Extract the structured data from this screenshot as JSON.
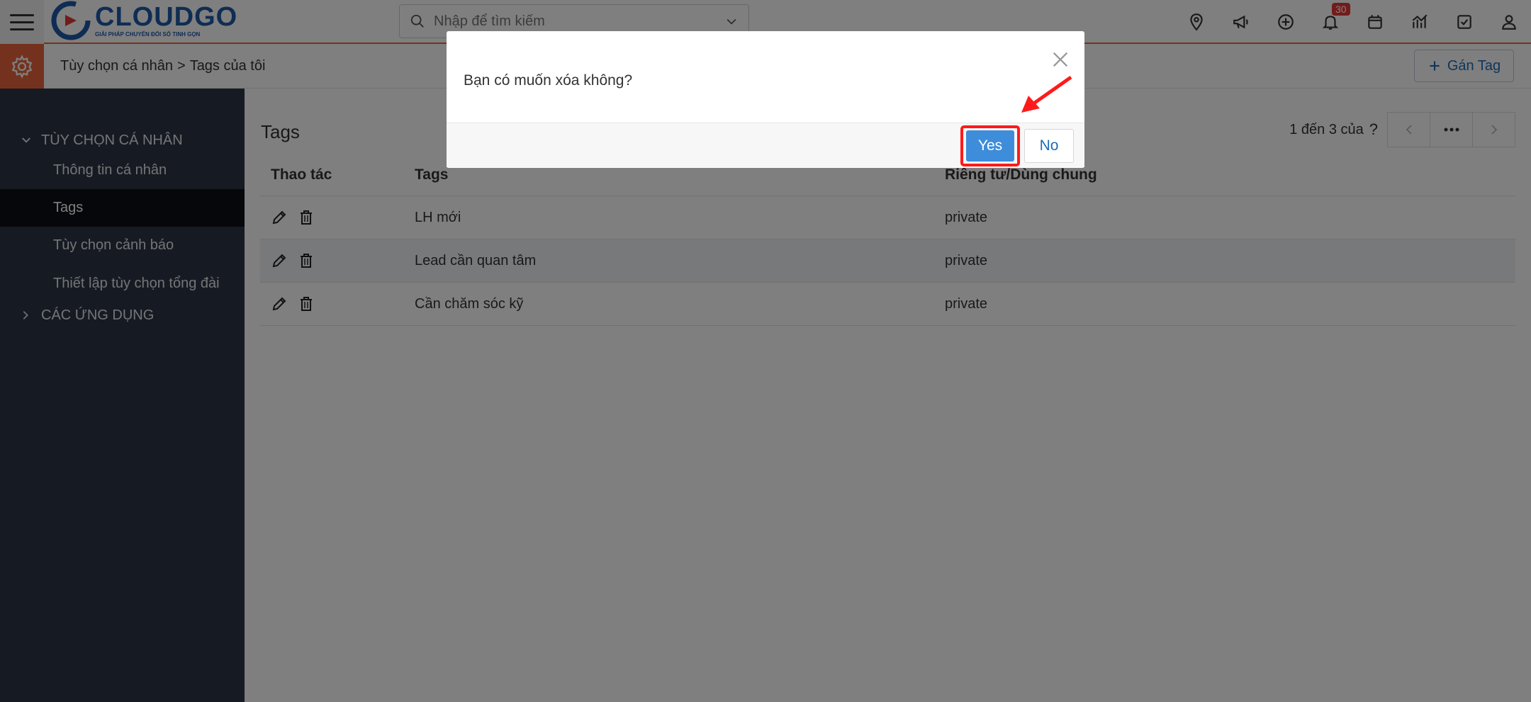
{
  "header": {
    "logo_word": "CLOUDGO",
    "logo_tagline": "GIẢI PHÁP CHUYỂN ĐỔI SỐ TINH GỌN",
    "search_placeholder": "Nhập để tìm kiếm",
    "notification_count": "30",
    "icons": [
      "map-pin-icon",
      "megaphone-icon",
      "plus-circle-icon",
      "bell-icon",
      "calendar-icon",
      "chart-icon",
      "checkbox-icon",
      "user-icon"
    ]
  },
  "breadcrumb": {
    "parent": "Tùy chọn cá nhân",
    "separator": ">",
    "current": "Tags của tôi"
  },
  "toolbar": {
    "assign_tag_label": "Gán Tag"
  },
  "sidebar": {
    "group_personal": "TÙY CHỌN CÁ NHÂN",
    "items": [
      {
        "label": "Thông tin cá nhân"
      },
      {
        "label": "Tags"
      },
      {
        "label": "Tùy chọn cảnh báo"
      },
      {
        "label": "Thiết lập tùy chọn tổng đài"
      }
    ],
    "group_apps": "CÁC ỨNG DỤNG"
  },
  "main": {
    "title": "Tags",
    "pager_text": "1 đến 3 của",
    "pager_help": "?",
    "columns": [
      "Thao tác",
      "Tags",
      "Riêng tư/Dùng chung"
    ],
    "rows": [
      {
        "tag": "LH mới",
        "visibility": "private"
      },
      {
        "tag": "Lead cần quan tâm",
        "visibility": "private"
      },
      {
        "tag": "Cần chăm sóc kỹ",
        "visibility": "private"
      }
    ]
  },
  "dialog": {
    "message": "Bạn có muốn xóa không?",
    "yes_label": "Yes",
    "no_label": "No"
  },
  "colors": {
    "accent": "#e8643c",
    "brand": "#1e5aa8",
    "sidebar_bg": "#2c3746",
    "primary_button": "#3d8ddb",
    "highlight": "#ff1a1a"
  }
}
